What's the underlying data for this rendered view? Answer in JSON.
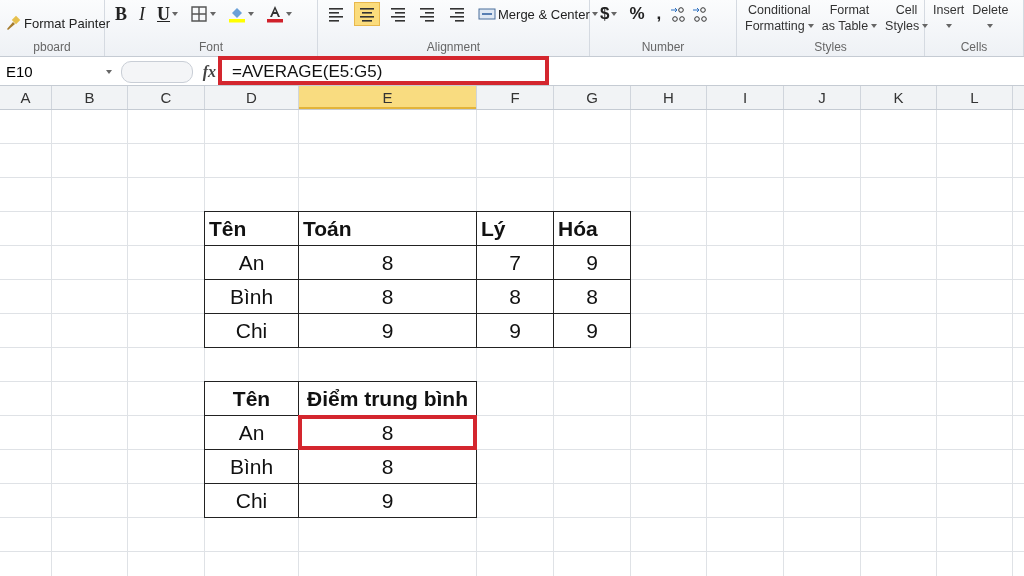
{
  "ribbon": {
    "groups": [
      {
        "kind": "clipboard",
        "label": "pboard",
        "items": [
          "Format Painter"
        ]
      },
      {
        "kind": "font",
        "label": "Font",
        "buttons": [
          "B",
          "I",
          "U"
        ]
      },
      {
        "kind": "alignment",
        "label": "Alignment",
        "align": [
          {
            "selected": false
          },
          {
            "selected": true
          },
          {
            "selected": false
          }
        ],
        "merge": "Merge & Center"
      },
      {
        "kind": "number",
        "label": "Number",
        "buttons": [
          "$",
          "%",
          ","
        ]
      },
      {
        "kind": "styles",
        "label": "Styles",
        "items": [
          [
            "Conditional",
            "Formatting"
          ],
          [
            "Format",
            "as Table"
          ],
          [
            "Cell",
            "Styles"
          ]
        ]
      },
      {
        "kind": "cells",
        "label": "Cells",
        "items": [
          "Insert",
          "Delete"
        ]
      }
    ]
  },
  "formula_bar": {
    "name_box": "E10",
    "fx": "fx",
    "formula": "=AVERAGE(E5:G5)",
    "highlighted": true
  },
  "sheet": {
    "columns": [
      {
        "label": "A",
        "selected": false
      },
      {
        "label": "B",
        "selected": false
      },
      {
        "label": "C",
        "selected": false
      },
      {
        "label": "D",
        "selected": false
      },
      {
        "label": "E",
        "selected": true
      },
      {
        "label": "F",
        "selected": false
      },
      {
        "label": "G",
        "selected": false
      },
      {
        "label": "H",
        "selected": false
      },
      {
        "label": "I",
        "selected": false
      },
      {
        "label": "J",
        "selected": false
      },
      {
        "label": "K",
        "selected": false
      },
      {
        "label": "L",
        "selected": false
      }
    ],
    "tables": [
      {
        "header": [
          "Tên",
          "Toán",
          "Lý",
          "Hóa"
        ],
        "rows": [
          {
            "cells": [
              "An",
              "8",
              "7",
              "9"
            ],
            "highlighted": false
          },
          {
            "cells": [
              "Bình",
              "8",
              "8",
              "8"
            ],
            "highlighted": false
          },
          {
            "cells": [
              "Chi",
              "9",
              "9",
              "9"
            ],
            "highlighted": false
          }
        ]
      },
      {
        "header": [
          "Tên",
          "Điểm trung bình"
        ],
        "rows": [
          {
            "cells": [
              "An",
              "8"
            ],
            "highlighted": true
          },
          {
            "cells": [
              "Bình",
              "8"
            ],
            "highlighted": false
          },
          {
            "cells": [
              "Chi",
              "9"
            ],
            "highlighted": false
          }
        ]
      }
    ]
  }
}
